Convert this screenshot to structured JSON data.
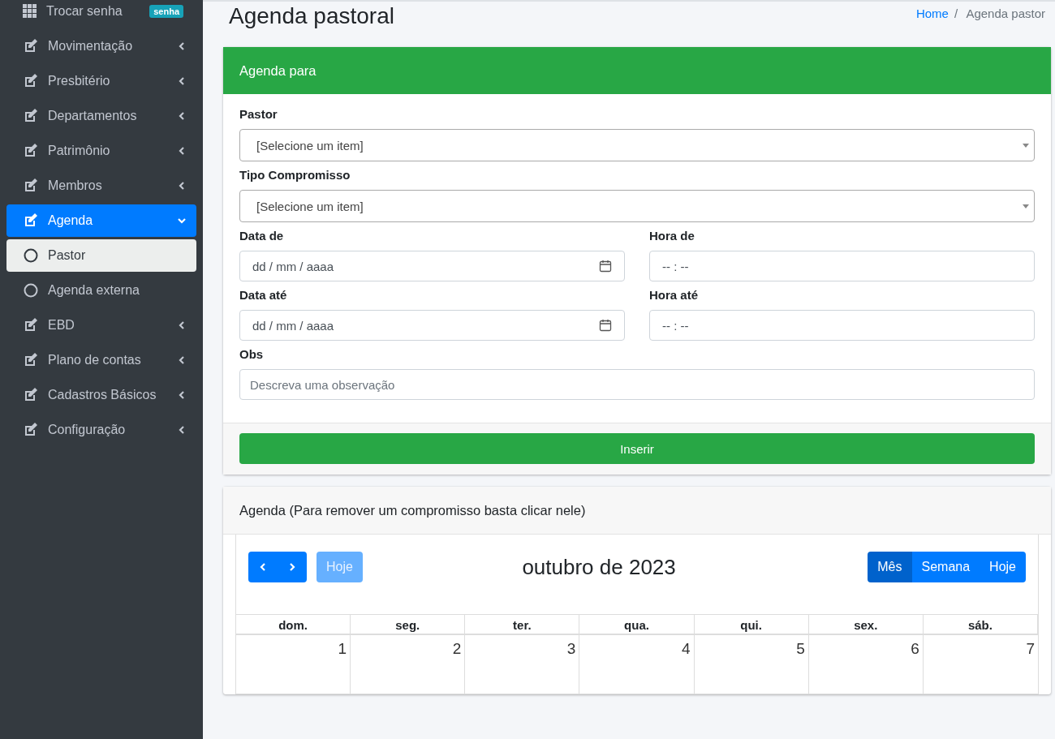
{
  "sidebar": {
    "items": [
      {
        "label": "Trocar senha",
        "kind": "grid",
        "badge": "senha"
      },
      {
        "label": "Movimentação",
        "kind": "edit",
        "expanded": false
      },
      {
        "label": "Presbitério",
        "kind": "edit",
        "expanded": false
      },
      {
        "label": "Departamentos",
        "kind": "edit",
        "expanded": false
      },
      {
        "label": "Patrimônio",
        "kind": "edit",
        "expanded": false
      },
      {
        "label": "Membros",
        "kind": "edit",
        "expanded": false
      },
      {
        "label": "Agenda",
        "kind": "edit",
        "expanded": true,
        "children": [
          {
            "label": "Pastor",
            "selected": true
          },
          {
            "label": "Agenda externa",
            "selected": false
          }
        ]
      },
      {
        "label": "EBD",
        "kind": "edit",
        "expanded": false
      },
      {
        "label": "Plano de contas",
        "kind": "edit",
        "expanded": false
      },
      {
        "label": "Cadastros Básicos",
        "kind": "edit",
        "expanded": false
      },
      {
        "label": "Configuração",
        "kind": "edit",
        "expanded": false
      }
    ]
  },
  "page": {
    "title": "Agenda pastoral",
    "breadcrumb_separator": "/",
    "breadcrumb": [
      {
        "label": "Home",
        "kind": "link"
      },
      {
        "label": "Agenda pastor",
        "kind": "current"
      }
    ]
  },
  "form": {
    "title": "Agenda para",
    "rows": [
      [
        {
          "label": "Pastor",
          "kind": "select",
          "value": "[Selecione um item]"
        }
      ],
      [
        {
          "label": "Tipo Compromisso",
          "kind": "select",
          "value": "[Selecione um item]"
        }
      ],
      [
        {
          "label": "Data de",
          "kind": "date",
          "placeholder": "dd / mm / aaaa"
        },
        {
          "label": "Hora de",
          "kind": "time",
          "placeholder": "-- : --"
        }
      ],
      [
        {
          "label": "Data até",
          "kind": "date",
          "placeholder": "dd / mm / aaaa"
        },
        {
          "label": "Hora até",
          "kind": "time",
          "placeholder": "-- : --"
        }
      ],
      [
        {
          "label": "Obs",
          "kind": "text",
          "placeholder": "Descreva uma observação"
        }
      ]
    ],
    "submit": "Inserir"
  },
  "calendar": {
    "title": "Agenda (Para remover um compromisso basta clicar nele)",
    "today_button": {
      "label": "Hoje",
      "disabled": true
    },
    "month": "outubro de 2023",
    "views": [
      {
        "label": "Mês",
        "selected": true
      },
      {
        "label": "Semana",
        "selected": false
      },
      {
        "label": "Hoje",
        "selected": false
      }
    ],
    "weekdays": [
      "dom.",
      "seg.",
      "ter.",
      "qua.",
      "qui.",
      "sex.",
      "sáb."
    ],
    "days": [
      "1",
      "2",
      "3",
      "4",
      "5",
      "6",
      "7"
    ]
  }
}
